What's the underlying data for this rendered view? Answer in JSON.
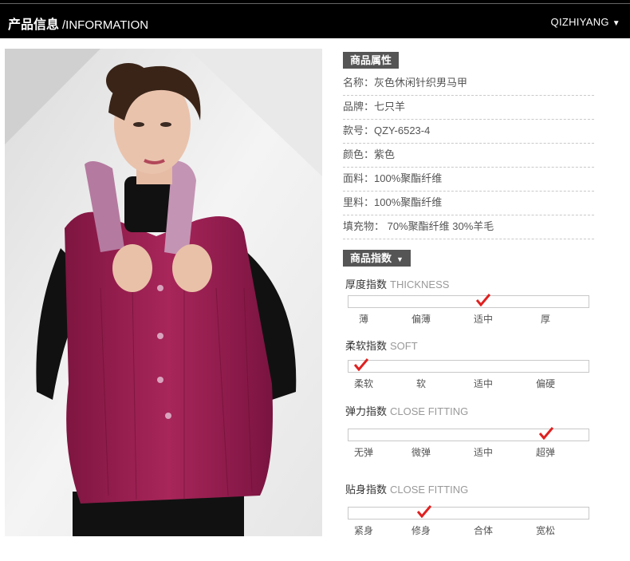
{
  "header": {
    "title_cn": "产品信息",
    "title_en": "/INFORMATION",
    "brand": "QIZHIYANG",
    "brand_caret": "▼"
  },
  "attributes": {
    "heading": "商品属性",
    "items": [
      "名称：灰色休闲针织男马甲",
      "品牌：七只羊",
      "款号：QZY-6523-4",
      "颜色：紫色",
      "面料：100%聚酯纤维",
      "里料：100%聚酯纤维",
      "填充物：  70%聚酯纤维 30%羊毛"
    ]
  },
  "indices": {
    "heading": "商品指数",
    "heading_caret": "▼",
    "groups": [
      {
        "title_cn": "厚度指数",
        "title_en": "THICKNESS",
        "labels": [
          "薄",
          "偏薄",
          "适中",
          "厚"
        ],
        "selected_index": 2
      },
      {
        "title_cn": "柔软指数",
        "title_en": "SOFT",
        "labels": [
          "柔软",
          "软",
          "适中",
          "偏硬"
        ],
        "selected_index": 0
      },
      {
        "title_cn": "弹力指数",
        "title_en": "CLOSE FITTING",
        "labels": [
          "无弹",
          "微弹",
          "适中",
          "超弹"
        ],
        "selected_index": 3
      },
      {
        "title_cn": "贴身指数",
        "title_en": "CLOSE FITTING",
        "labels": [
          "紧身",
          "修身",
          "合体",
          "宽松"
        ],
        "selected_index": 1
      }
    ]
  },
  "colors": {
    "check": "#e02020",
    "vest": "#9b1f4f",
    "header_bg": "#000000",
    "section_bg": "#555555"
  }
}
